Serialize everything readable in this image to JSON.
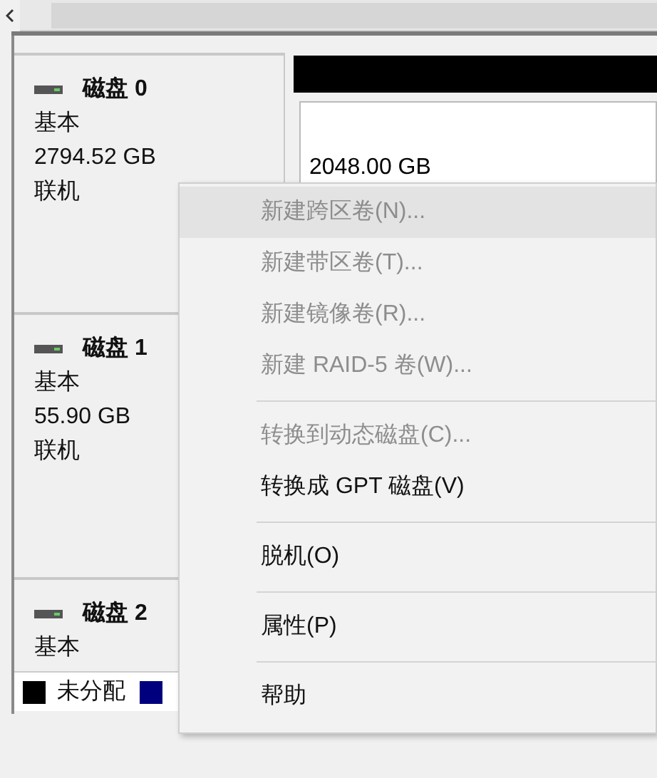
{
  "disks": [
    {
      "name": "磁盘 0",
      "type": "基本",
      "size": "2794.52 GB",
      "status": "联机"
    },
    {
      "name": "磁盘 1",
      "type": "基本",
      "size": "55.90 GB",
      "status": "联机"
    },
    {
      "name": "磁盘 2",
      "type": "基本"
    }
  ],
  "volume_header": {
    "color": "#000000"
  },
  "partition": {
    "size": "2048.00 GB"
  },
  "legend": [
    {
      "label": "未分配",
      "color": "#000000"
    },
    {
      "color": "#00007f"
    }
  ],
  "context_menu": {
    "items": [
      {
        "kind": "item",
        "label": "新建跨区卷(N)...",
        "disabled": true,
        "selected": true
      },
      {
        "kind": "item",
        "label": "新建带区卷(T)...",
        "disabled": true,
        "selected": false
      },
      {
        "kind": "item",
        "label": "新建镜像卷(R)...",
        "disabled": true,
        "selected": false
      },
      {
        "kind": "item",
        "label": "新建 RAID-5 卷(W)...",
        "disabled": true,
        "selected": false
      },
      {
        "kind": "separator"
      },
      {
        "kind": "item",
        "label": "转换到动态磁盘(C)...",
        "disabled": true,
        "selected": false
      },
      {
        "kind": "item",
        "label": "转换成 GPT 磁盘(V)",
        "disabled": false,
        "selected": false
      },
      {
        "kind": "separator"
      },
      {
        "kind": "item",
        "label": "脱机(O)",
        "disabled": false,
        "selected": false
      },
      {
        "kind": "separator"
      },
      {
        "kind": "item",
        "label": "属性(P)",
        "disabled": false,
        "selected": false
      },
      {
        "kind": "separator"
      },
      {
        "kind": "item",
        "label": "帮助",
        "disabled": false,
        "selected": false
      }
    ]
  }
}
